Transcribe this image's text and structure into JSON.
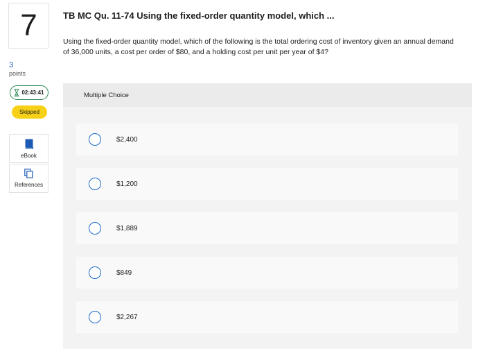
{
  "question": {
    "number": "7",
    "points_value": "3",
    "points_label": "points",
    "timer": "02:43:41",
    "status": "Skipped",
    "title": "TB MC Qu. 11-74 Using the fixed-order quantity model, which ...",
    "text": "Using the fixed-order quantity model, which of the following is the total ordering cost of inventory given an annual demand of 36,000 units, a cost per order of $80, and a holding cost per unit per year of $4?"
  },
  "tools": {
    "ebook_label": "eBook",
    "references_label": "References"
  },
  "answer": {
    "header": "Multiple Choice",
    "choices": [
      "$2,400",
      "$1,200",
      "$1,889",
      "$849",
      "$2,267"
    ]
  },
  "colors": {
    "accent_blue": "#1b6ac9",
    "timer_border": "#2e8b57",
    "badge_yellow": "#f7d117",
    "panel_bg": "#f3f3f3"
  },
  "icons": {
    "timer": "hourglass-icon",
    "ebook": "book-icon",
    "references": "copy-pages-icon",
    "choice": "radio-icon"
  }
}
